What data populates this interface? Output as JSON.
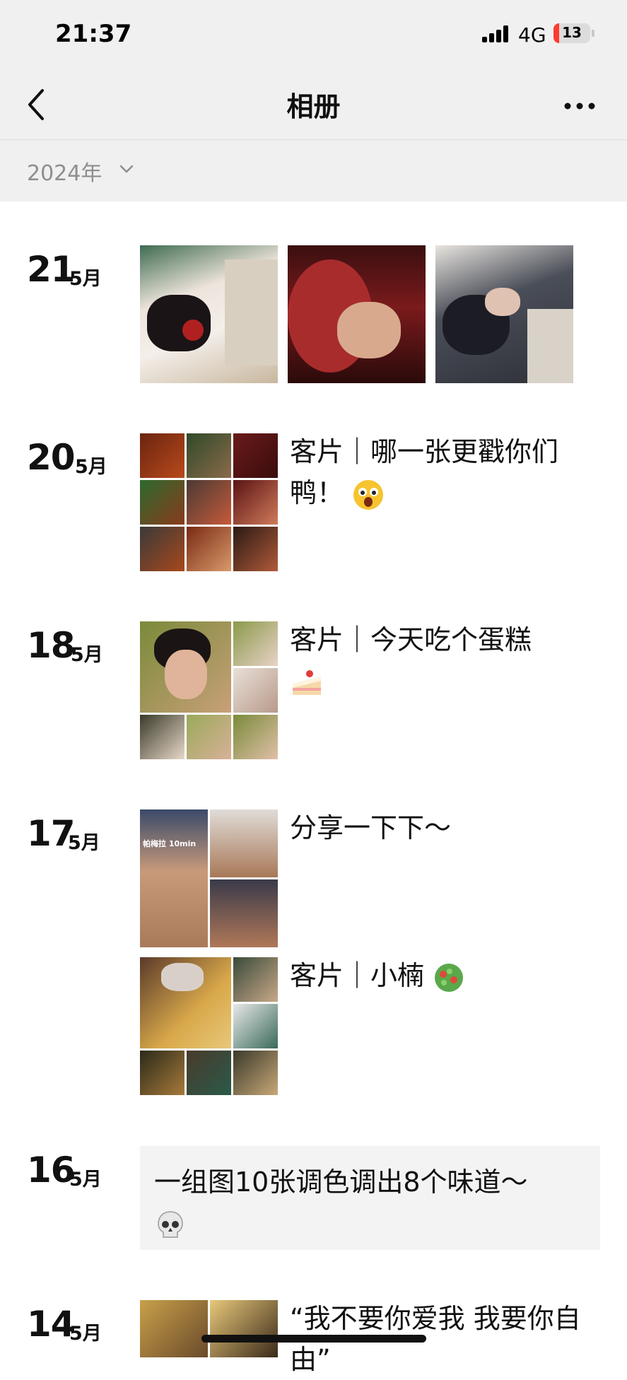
{
  "status": {
    "time": "21:37",
    "network": "4G",
    "battery": "13"
  },
  "nav": {
    "title": "相册"
  },
  "year_filter": {
    "label": "2024年"
  },
  "entries": [
    {
      "day": "21",
      "month": "5月"
    },
    {
      "day": "20",
      "month": "5月",
      "text": "客片｜哪一张更戳你们鸭！"
    },
    {
      "day": "18",
      "month": "5月",
      "text": "客片｜今天吃个蛋糕"
    },
    {
      "day": "17",
      "month": "5月",
      "text": "分享一下下～",
      "text2": "客片｜小楠"
    },
    {
      "day": "16",
      "month": "5月",
      "text": "一组图10张调色调出8个味道～"
    },
    {
      "day": "14",
      "month": "5月",
      "text": "“我不要你爱我 我要你自由”"
    }
  ],
  "photo_overlay_text": "帕梅拉 10min",
  "icons": {
    "back": "chevron-left-icon",
    "more": "more-dots-icon",
    "dropdown": "chevron-down-icon",
    "emoji_20": "surprised-face-emoji",
    "emoji_18": "cake-emoji",
    "emoji_17": "salad-emoji",
    "emoji_16": "skull-emoji"
  },
  "colors": {
    "accent_red": "#ff3b30",
    "header_bg": "#f0f0f0",
    "muted": "#8e8e8e"
  }
}
